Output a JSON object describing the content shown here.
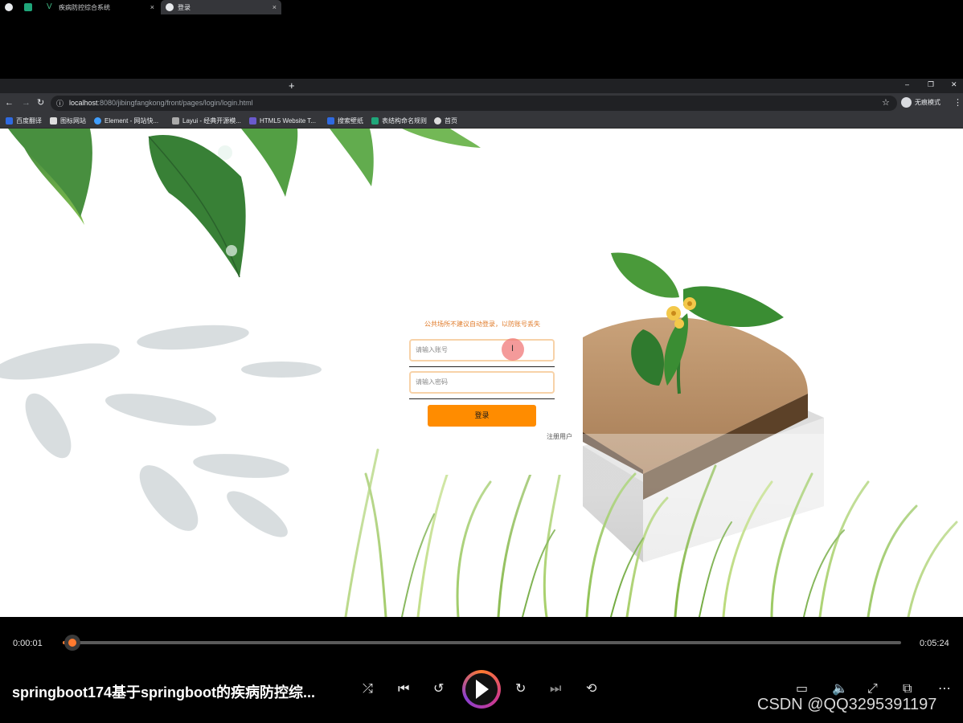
{
  "browser": {
    "tabs": [
      {
        "label": "",
        "icon": "globe-icon"
      },
      {
        "label": "",
        "icon": "app-icon"
      },
      {
        "label": "疾病防控综合系统",
        "icon": "vue-icon",
        "active": false
      },
      {
        "label": "登录",
        "icon": "globe-icon",
        "active": true
      }
    ],
    "tab_close_glyph": "×",
    "new_tab_glyph": "+",
    "window_controls": [
      "–",
      "❐",
      "✕"
    ],
    "url_host": "localhost",
    "url_path": ":8080/jibingfangkong/front/pages/login/login.html",
    "incognito_label": "无痕模式",
    "bookmarks": [
      {
        "label": "百度翻译",
        "color": "#2f6ae0"
      },
      {
        "label": "图标网站",
        "color": "#dddddd"
      },
      {
        "label": "Element - 网站快...",
        "color": "#409eff"
      },
      {
        "label": "Layui - 经典开源模...",
        "color": "#aaaaaa"
      },
      {
        "label": "HTML5 Website T...",
        "color": "#6a5acd"
      },
      {
        "label": "搜索壁纸",
        "color": "#2f6ae0"
      },
      {
        "label": "表结构命名规则",
        "color": "#1fa67a"
      },
      {
        "label": "首页",
        "color": "#dddddd"
      }
    ]
  },
  "login": {
    "notice": "公共场所不建议自动登录，以防账号丢失",
    "account_placeholder": "请输入账号",
    "password_placeholder": "请输入密码",
    "login_button": "登录",
    "register_link": "注册用户",
    "cursor_glyph": "I"
  },
  "player": {
    "current_time": "0:00:01",
    "total_time": "0:05:24",
    "progress": 0.003,
    "title": "springboot174基于springboot的疾病防控综...",
    "accent": "#ff7a2f"
  },
  "watermark": "CSDN @QQ3295391197"
}
